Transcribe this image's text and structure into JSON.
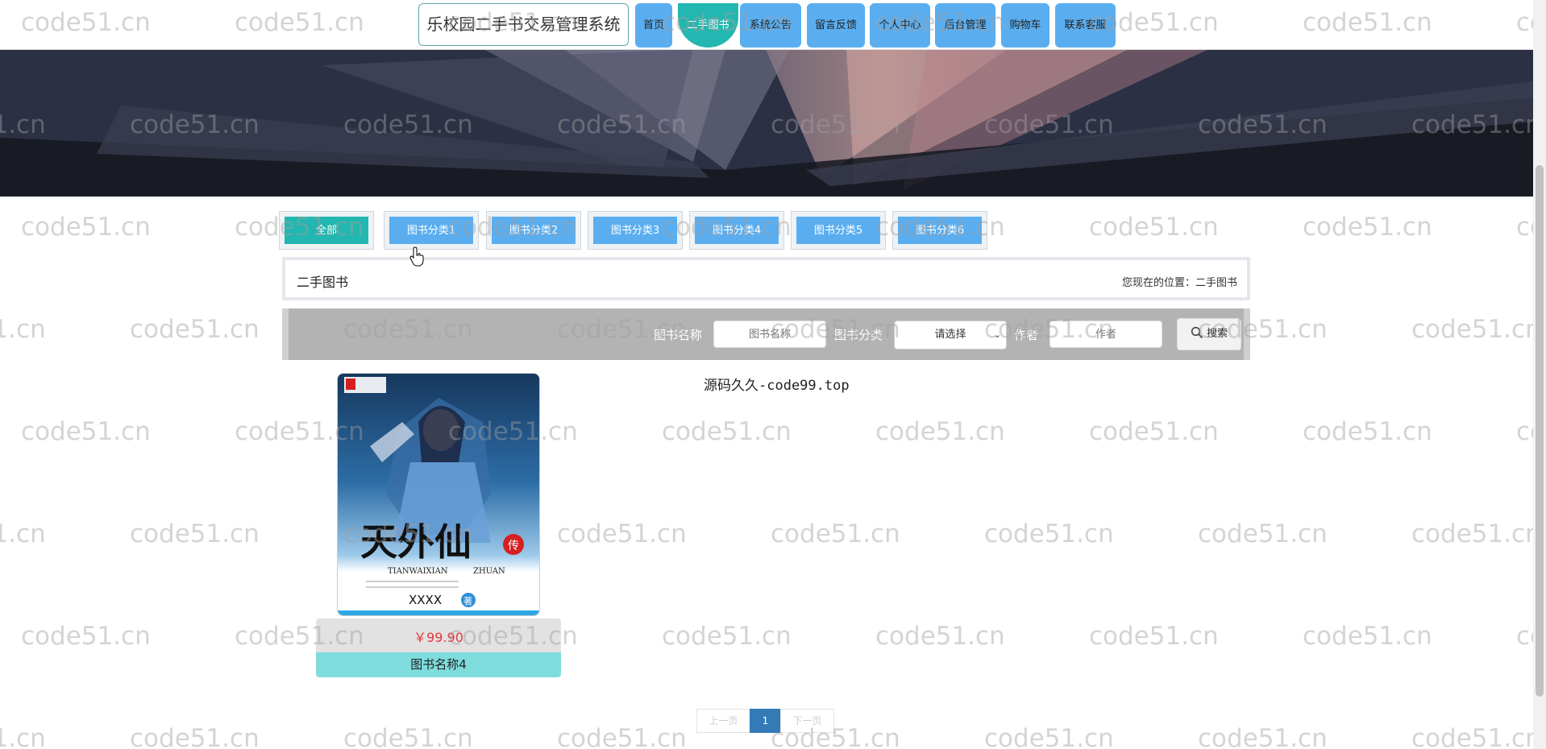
{
  "header": {
    "site_title": "乐校园二手书交易管理系统",
    "nav": [
      "首页",
      "二手图书",
      "系统公告",
      "留言反馈",
      "个人中心",
      "后台管理",
      "购物车",
      "联系客服"
    ],
    "active_index": 1
  },
  "categories": {
    "items": [
      "全部",
      "图书分类1",
      "图书分类2",
      "图书分类3",
      "图书分类4",
      "图书分类5",
      "图书分类6"
    ],
    "active_index": 0
  },
  "section": {
    "title": "二手图书",
    "location": "您现在的位置：二手图书"
  },
  "search": {
    "name_label": "图书名称",
    "name_placeholder": "图书名称",
    "category_label": "图书分类",
    "category_selected": "请选择",
    "author_label": "作者",
    "author_placeholder": "作者",
    "button_label": "搜索"
  },
  "promo_text": "源码久久-code99.top",
  "products": [
    {
      "price": "￥99.90",
      "name": "图书名称4",
      "cover": {
        "title_chars": "天外仙",
        "badge_char": "传",
        "pinyin_left": "TIANWAIXIAN",
        "pinyin_right": "ZHUAN",
        "author": "XXXX",
        "publisher_badge": "著"
      }
    }
  ],
  "pagination": {
    "prev": "上一页",
    "current": "1",
    "next": "下一页"
  },
  "watermark": "code51.cn",
  "colors": {
    "nav_blue": "#5aaef0",
    "active_teal": "#22b7b0",
    "price_red": "#e4393c",
    "name_bg": "#7fdcdc",
    "search_bg": "#b3b3b3"
  },
  "icons": {
    "search": "magnifier-icon",
    "select": "chevron-down-icon",
    "cursor": "hand-pointer-icon"
  }
}
